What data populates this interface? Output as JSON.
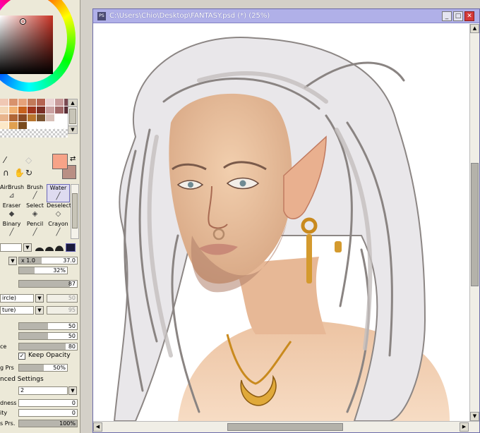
{
  "document": {
    "title": "C:\\Users\\Chio\\Desktop\\FANTASY.psd (*) (25%)",
    "app_icon_text": "PS",
    "minimize_icon": "minimize-icon",
    "maximize_icon": "maximize-icon",
    "close_icon": "close-icon"
  },
  "colors": {
    "foreground": "#f7a388",
    "background": "#b98f84",
    "title_bar": "#b0b0e8"
  },
  "swatches": [
    "#f0c8b4",
    "#d8926c",
    "#e6a27a",
    "#c27a5a",
    "#b46452",
    "#ead4d4",
    "#c89a9a",
    "#7a4a52",
    "#f4d8b8",
    "#f0b070",
    "#c8621e",
    "#a0361e",
    "#7a2e24",
    "#caa0a0",
    "#a06666",
    "#5a2e36",
    "#e8b48c",
    "#b06636",
    "#8a4a24",
    "#b8742c",
    "#7a5430",
    "#d8c0b8",
    "#ffffff",
    "#ffffff",
    "#fce8c8",
    "#e0a050",
    "#7a4a1c",
    "#ffffff",
    "#ffffff",
    "#ffffff",
    "#ffffff",
    "#ffffff"
  ],
  "tools": {
    "row1": [
      "picker-icon",
      "blur-icon"
    ],
    "row2": [
      "lasso-icon",
      "hand-icon",
      "rotate-icon"
    ]
  },
  "brushes": [
    {
      "label": "AirBrush",
      "icon": "airbrush-icon",
      "selected": false
    },
    {
      "label": "Brush",
      "icon": "brush-icon",
      "selected": false
    },
    {
      "label": "Water",
      "icon": "water-icon",
      "selected": true
    },
    {
      "label": "Eraser",
      "icon": "eraser-icon",
      "selected": false
    },
    {
      "label": "Select",
      "icon": "select-icon",
      "selected": false
    },
    {
      "label": "Deselect",
      "icon": "deselect-icon",
      "selected": false
    },
    {
      "label": "Binary",
      "icon": "binary-icon",
      "selected": false
    },
    {
      "label": "Pencil",
      "icon": "pencil-icon",
      "selected": false
    },
    {
      "label": "Crayon",
      "icon": "crayon-icon",
      "selected": false
    }
  ],
  "settings": {
    "size_multiplier": "x 1.0",
    "size_value": "37.0",
    "min_size": "32%",
    "density": "87",
    "shape_dropdown": "ircle)",
    "shape_value": "50",
    "texture_dropdown": "ture)",
    "texture_value": "95",
    "blending": "50",
    "dilution": "50",
    "persistence_label": "ce",
    "persistence": "80",
    "keep_opacity_label": "Keep Opacity",
    "keep_opacity_checked": true,
    "blending_prs_label": "g Prs",
    "blending_prs": "50%",
    "advanced_label": "nced Settings",
    "quality": "2",
    "hardness_label": "dness",
    "hardness": "0",
    "density_label": "ity",
    "density_value": "0",
    "size_prs_label": "s Prs.",
    "size_prs": "100%"
  }
}
